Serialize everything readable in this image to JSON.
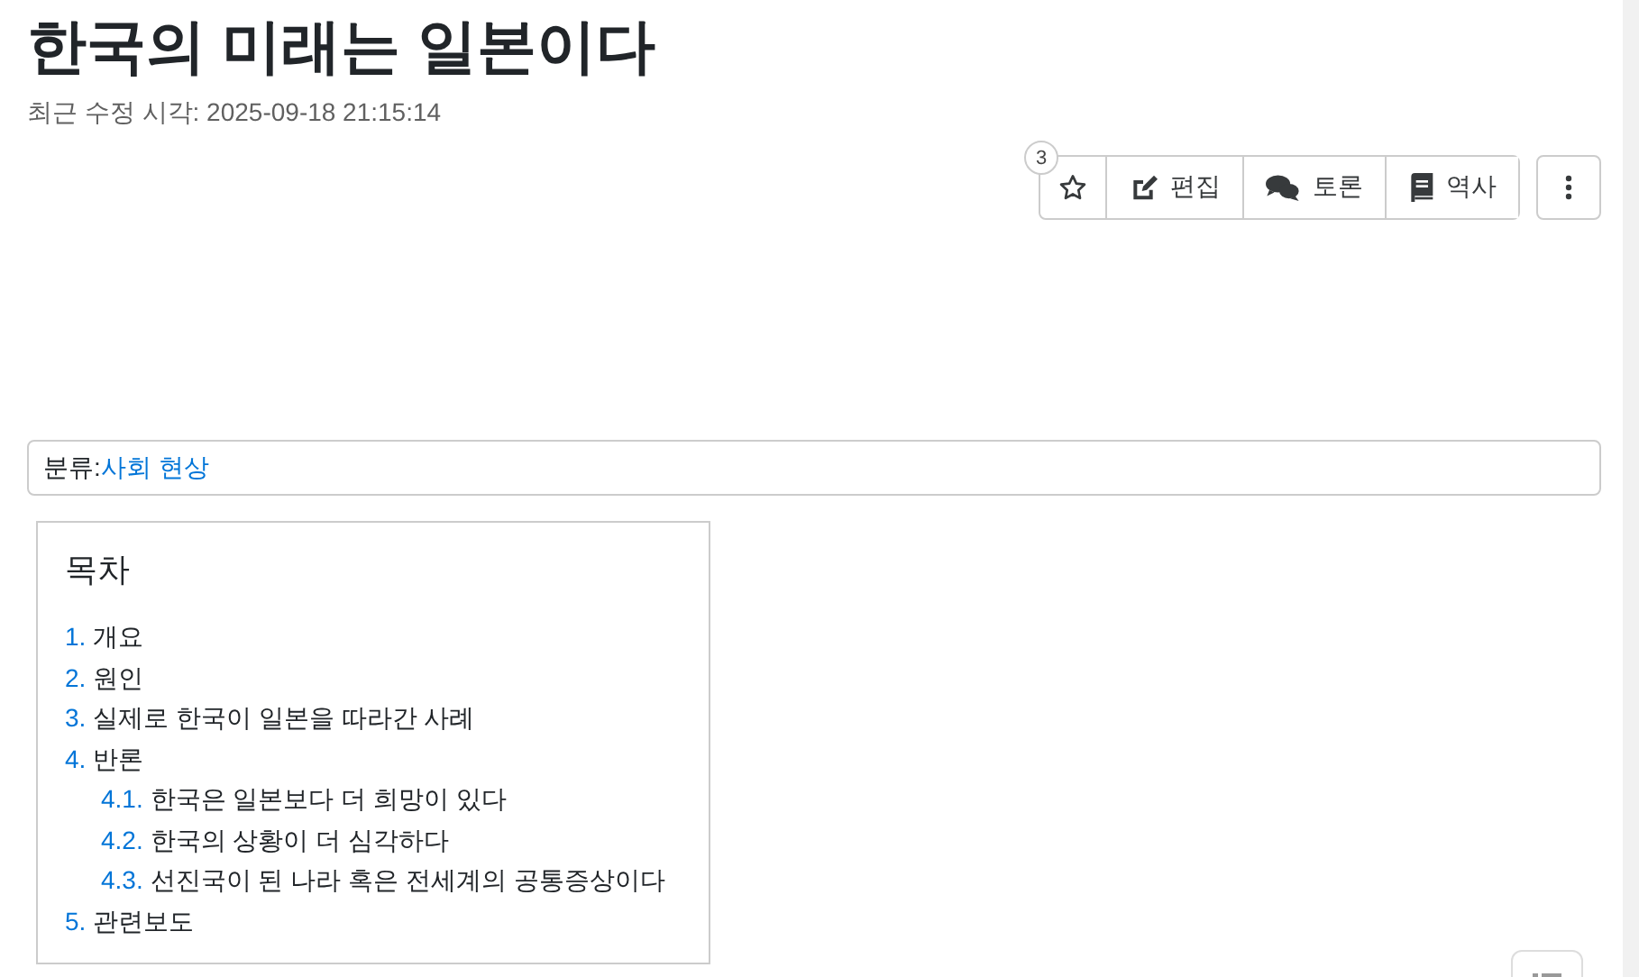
{
  "title": "한국의 미래는 일본이다",
  "last_modified": "최근 수정 시각: 2025-09-18 21:15:14",
  "toolbar": {
    "star_count": "3",
    "buttons": [
      {
        "kind": "star"
      },
      {
        "kind": "edit",
        "label": "편집"
      },
      {
        "kind": "discuss",
        "label": "토론"
      },
      {
        "kind": "history",
        "label": "역사"
      }
    ]
  },
  "category": {
    "label": "분류:",
    "link": "사회 현상"
  },
  "toc": {
    "title": "목차",
    "items": [
      {
        "number": "1.",
        "text": "개요"
      },
      {
        "number": "2.",
        "text": "원인"
      },
      {
        "number": "3.",
        "text": "실제로 한국이 일본을 따라간 사례"
      },
      {
        "number": "4.",
        "text": "반론",
        "children": [
          {
            "number": "4.1.",
            "text": "한국은 일본보다 더 희망이 있다"
          },
          {
            "number": "4.2.",
            "text": "한국의 상황이 더 심각하다"
          },
          {
            "number": "4.3.",
            "text": "선진국이 된 나라 혹은 전세계의 공통증상이다"
          }
        ]
      },
      {
        "number": "5.",
        "text": "관련보도"
      }
    ]
  }
}
